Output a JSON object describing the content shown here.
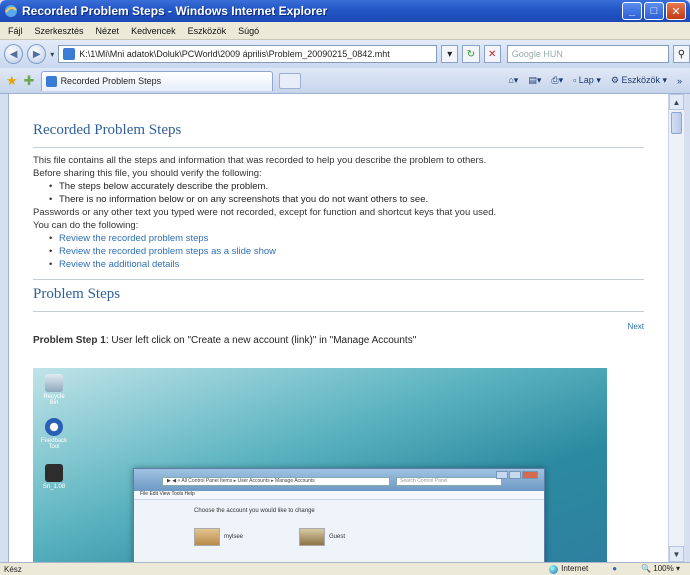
{
  "window": {
    "title": "Recorded Problem Steps - Windows Internet Explorer",
    "buttons": {
      "minimize": "_",
      "maximize": "□",
      "close": "✕"
    }
  },
  "menu": [
    "Fájl",
    "Szerkesztés",
    "Nézet",
    "Kedvencek",
    "Eszközök",
    "Súgó"
  ],
  "address": {
    "url": "K:\\1\\Mi\\Mni adatok\\Doluk\\PCWorld\\2009 április\\Problem_20090215_0842.mht",
    "search_placeholder": "Google HUN"
  },
  "tabs": {
    "active": "Recorded Problem Steps"
  },
  "command_bar": {
    "page": "Lap",
    "tools": "Eszközök"
  },
  "page": {
    "heading": "Recorded Problem Steps",
    "intro1": "This file contains all the steps and information that was recorded to help you describe the problem to others.",
    "intro2": "Before sharing this file, you should verify the following:",
    "verify": [
      "The steps below accurately describe the problem.",
      "There is no information below or on any screenshots that you do not want others to see."
    ],
    "note": "Passwords or any other text you typed were not recorded, except for function and shortcut keys that you used.",
    "cando": "You can do the following:",
    "links": [
      "Review the recorded problem steps",
      "Review the recorded problem steps as a slide show",
      "Review the additional details"
    ],
    "steps_heading": "Problem Steps",
    "next": "Next",
    "step_label": "Problem Step 1",
    "step_text": ": User left click on \"Create a new account (link)\" in \"Manage Accounts\""
  },
  "screenshot": {
    "desktop_icons": [
      "Recycle Bin",
      "Feedback Tool",
      "Sn_1.08"
    ],
    "inner_address": "▶ ◀ « All Control Panel Items ▸ User Accounts ▸ Manage Accounts",
    "inner_search": "Search Control Panel",
    "inner_menu": "File   Edit   View   Tools   Help",
    "inner_title": "Choose the account you would like to change",
    "accounts": [
      "mylsee",
      "Guest"
    ]
  },
  "status": {
    "left": "Kész",
    "zone": "Internet",
    "zoom": "100%"
  }
}
